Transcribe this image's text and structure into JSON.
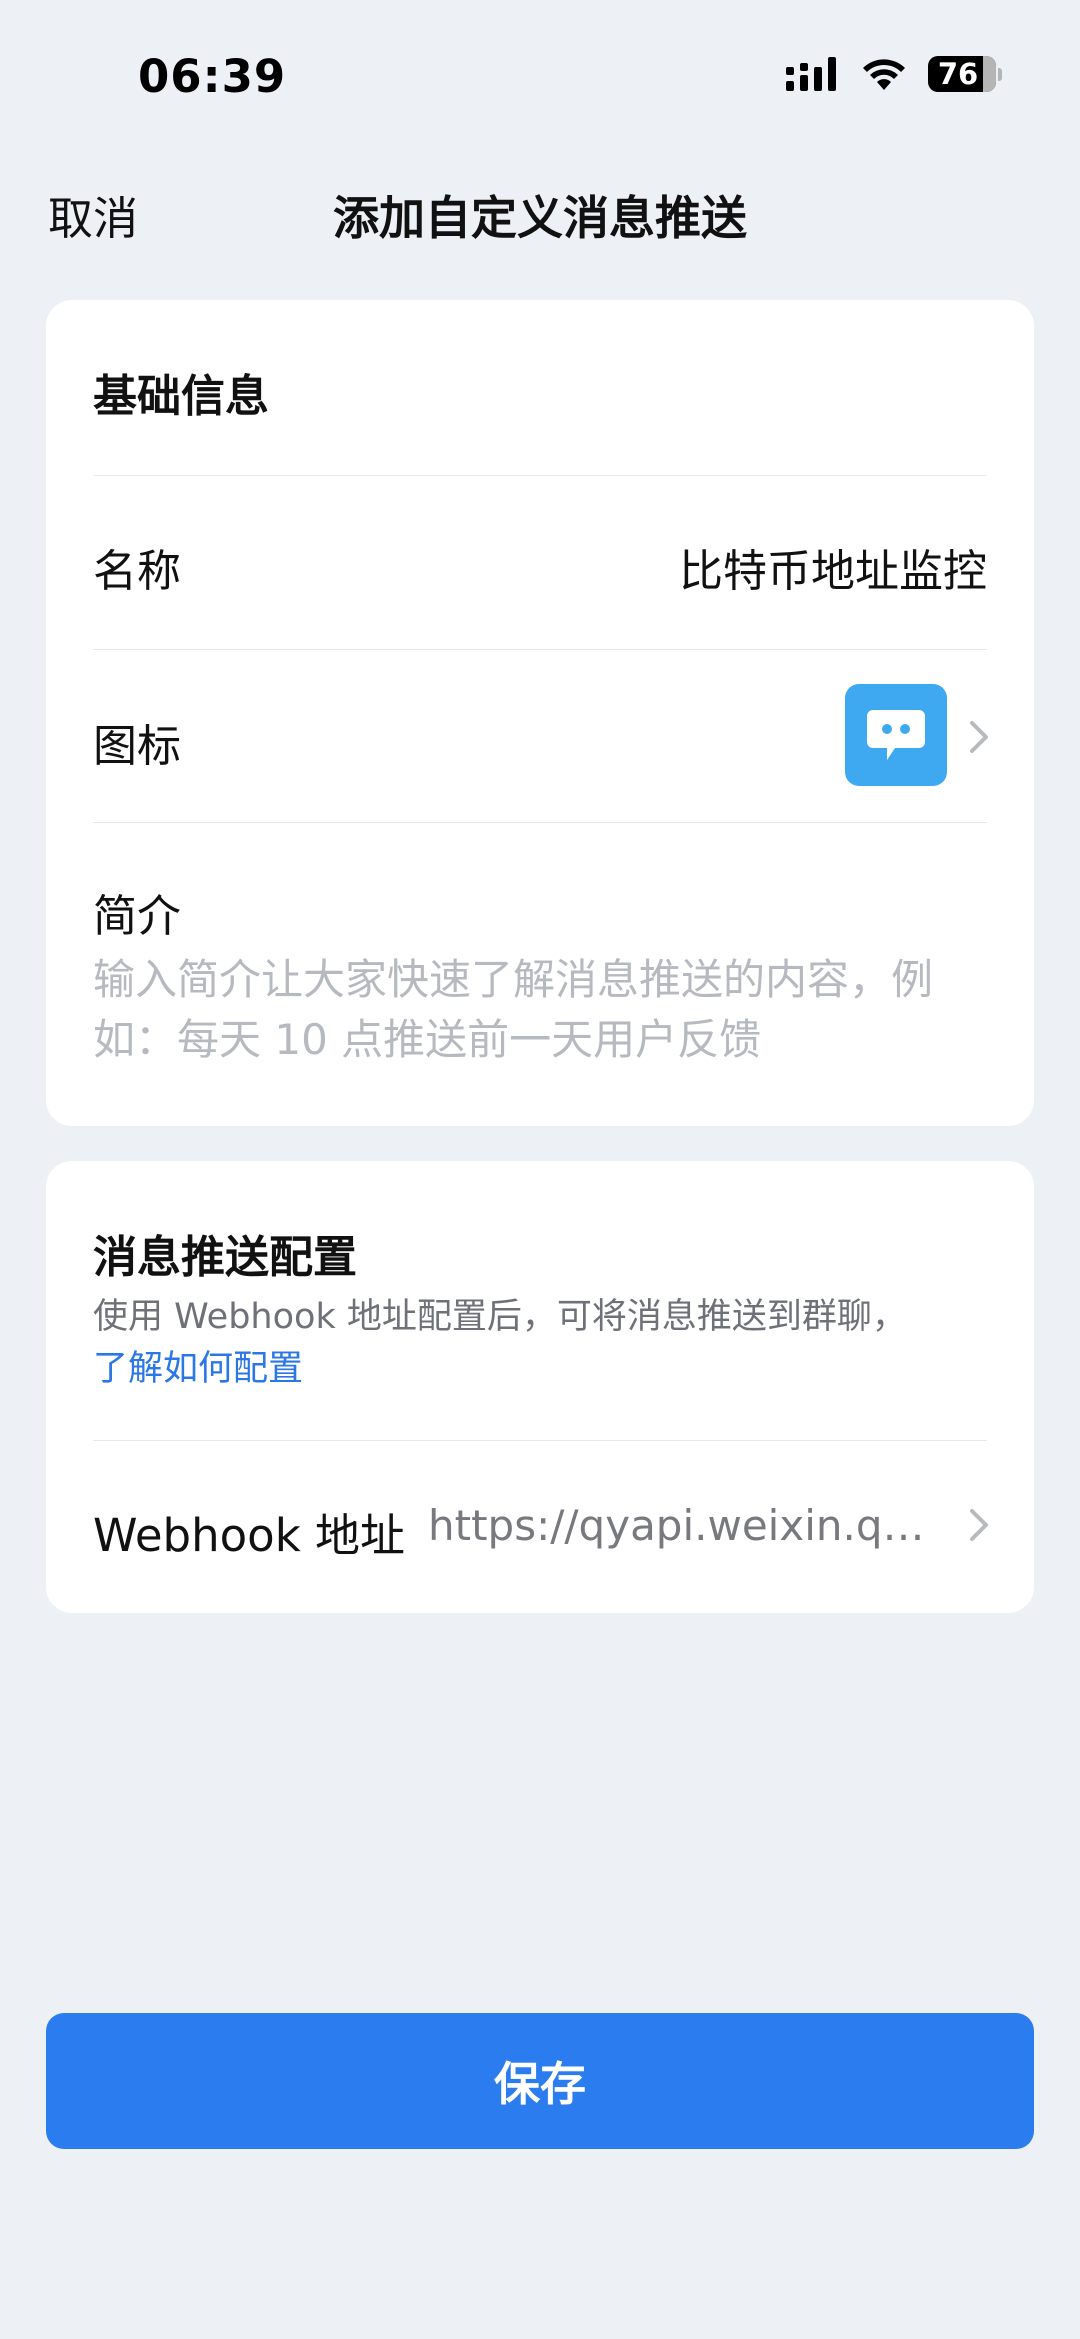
{
  "status_bar": {
    "time": "06:39",
    "battery": "76"
  },
  "nav": {
    "cancel_label": "取消",
    "title": "添加自定义消息推送"
  },
  "basic_info": {
    "section_title": "基础信息",
    "name_label": "名称",
    "name_value": "比特币地址监控",
    "icon_label": "图标",
    "intro_label": "简介",
    "intro_placeholder": "输入简介让大家快速了解消息推送的内容，例如：每天 10 点推送前一天用户反馈"
  },
  "push_config": {
    "section_title": "消息推送配置",
    "description": "使用 Webhook 地址配置后，可将消息推送到群聊，",
    "link_label": "了解如何配置",
    "webhook_label": "Webhook 地址",
    "webhook_value": "https://qyapi.weixin.qq.com/cgi-bin/webhook/send?key=..."
  },
  "actions": {
    "save_label": "保存"
  },
  "colors": {
    "background": "#edf0f5",
    "primary": "#2b7cef",
    "link": "#2b77e6",
    "icon_bg": "#3ea9f0"
  }
}
